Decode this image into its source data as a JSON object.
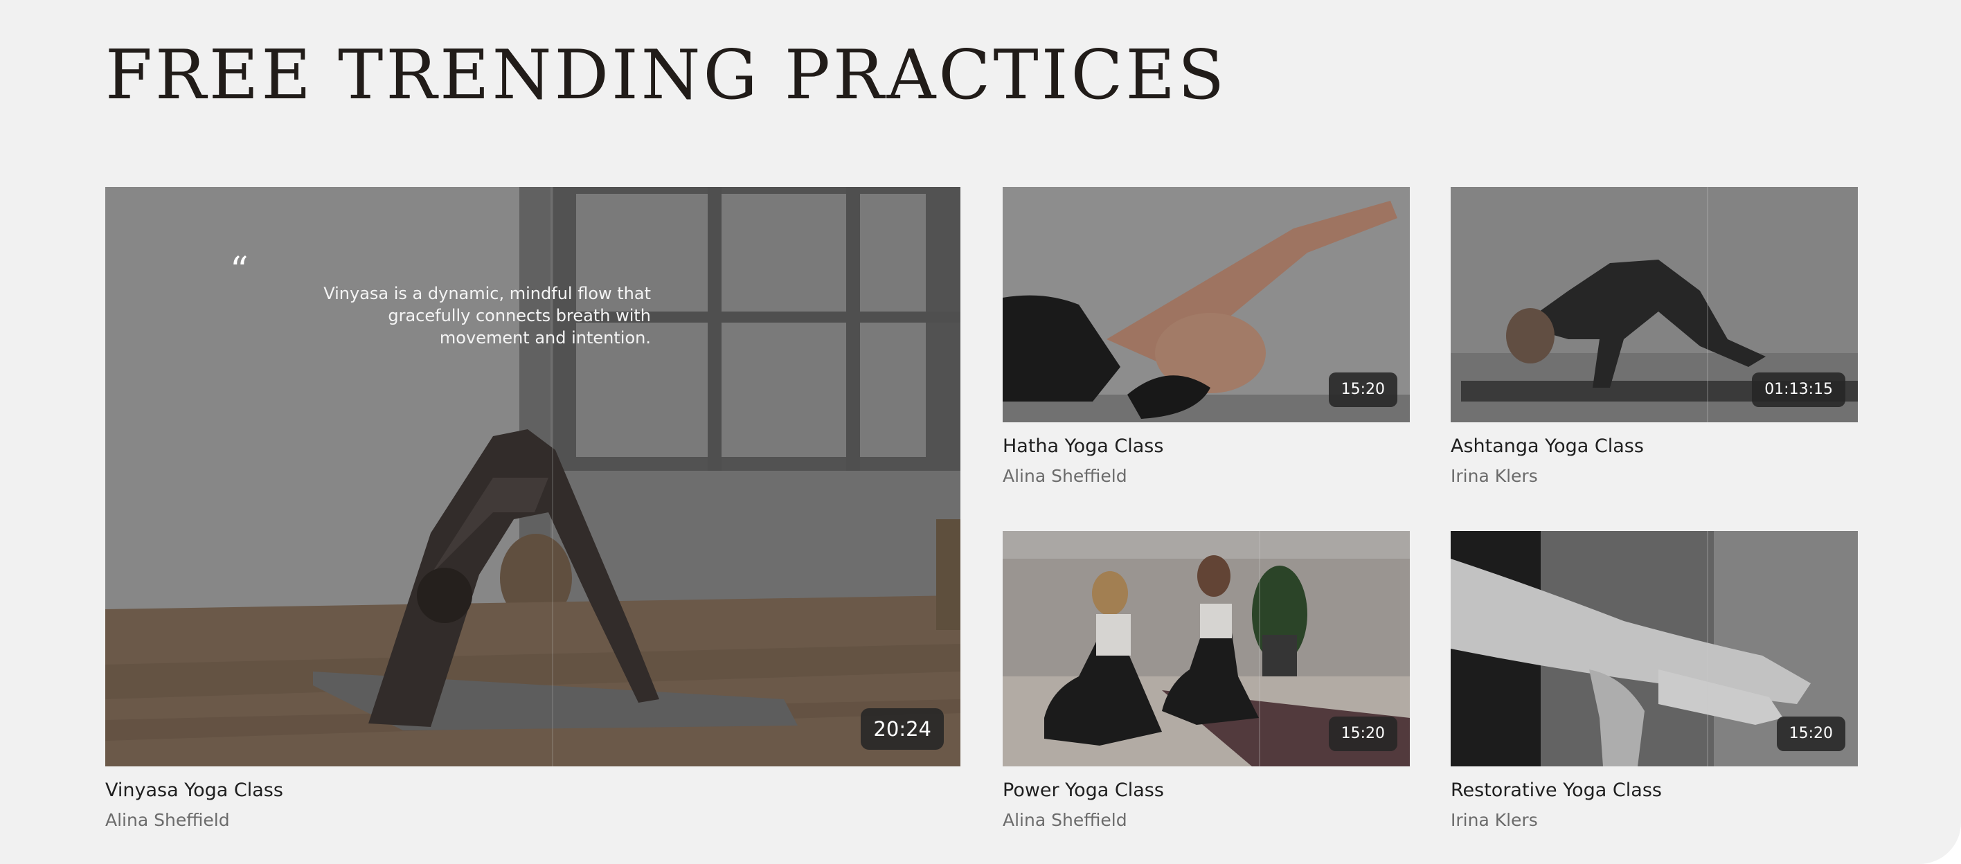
{
  "section": {
    "title": "FREE TRENDING PRACTICES"
  },
  "featured": {
    "quote_mark": "“",
    "quote": "Vinyasa is a dynamic, mindful flow that gracefully connects breath with movement and intention.",
    "duration": "20:24",
    "title": "Vinyasa Yoga Class",
    "author": "Alina Sheffield"
  },
  "cards": [
    {
      "title": "Hatha Yoga Class",
      "author": "Alina Sheffield",
      "duration": "15:20"
    },
    {
      "title": "Ashtanga Yoga Class",
      "author": "Irina Klers",
      "duration": "01:13:15"
    },
    {
      "title": "Power Yoga Class",
      "author": "Alina Sheffield",
      "duration": "15:20"
    },
    {
      "title": "Restorative Yoga Class",
      "author": "Irina Klers",
      "duration": "15:20"
    }
  ],
  "colors": {
    "background": "#f1f1f1",
    "title": "#211c19",
    "badge": "#262626",
    "author": "#6b6b6b"
  }
}
